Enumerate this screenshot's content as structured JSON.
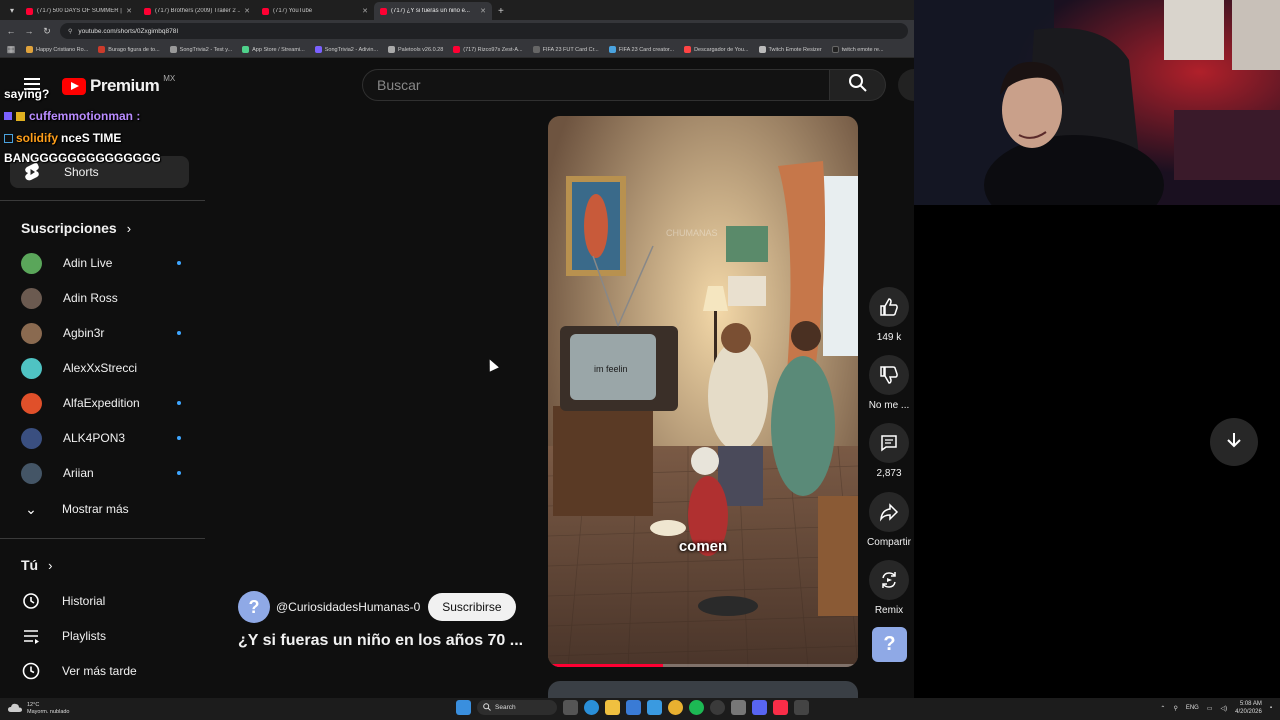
{
  "browser": {
    "tabs": [
      {
        "title": "(717) 500 DAYS OF SUMMER | ...",
        "active": false
      },
      {
        "title": "(717) Brothers (2009) Trailer 2 ...",
        "active": false
      },
      {
        "title": "(717) YouTube",
        "active": false
      },
      {
        "title": "(717) ¿Y si fueras un niño e...",
        "active": true
      }
    ],
    "url": "youtube.com/shorts/0Zxgimbq878I",
    "bookmarks": [
      "Happy Cristiano Ro...",
      "Burago figura de to...",
      "SongTrivia2 - Test y...",
      "App Store / Streami...",
      "SongTrivia2 - Adivin...",
      "Paletools v26.0.28",
      "(717) Rizco97s Zest-A...",
      "FIFA 23 FUT Card Cr...",
      "FIFA 23 Card creator...",
      "Descargador de You...",
      "Twitch Emote Resizer",
      "twitch emote re..."
    ]
  },
  "youtube": {
    "logo_text": "Premium",
    "region": "MX",
    "search_placeholder": "Buscar",
    "shorts_label": "Shorts",
    "subscriptions_heading": "Suscripciones",
    "subscriptions": [
      {
        "name": "Adin Live",
        "new": true,
        "color": "#5aa65a"
      },
      {
        "name": "Adin Ross",
        "new": false,
        "color": "#6b5a50"
      },
      {
        "name": "Agbin3r",
        "new": true,
        "color": "#8a6a50"
      },
      {
        "name": "AlexXxStrecci",
        "new": false,
        "color": "#4fc3c3"
      },
      {
        "name": "AlfaExpedition",
        "new": true,
        "color": "#e0502a"
      },
      {
        "name": "ALK4PON3",
        "new": true,
        "color": "#3a4f80"
      },
      {
        "name": "Ariian",
        "new": true,
        "color": "#445566"
      }
    ],
    "show_more": "Mostrar más",
    "you_heading": "Tú",
    "you_items": [
      {
        "label": "Historial",
        "icon": "history-icon"
      },
      {
        "label": "Playlists",
        "icon": "playlists-icon"
      },
      {
        "label": "Ver más tarde",
        "icon": "watch-later-icon"
      }
    ],
    "video": {
      "caption": "comen",
      "tv_text": "im feelin",
      "watermark": "CHUMANAS",
      "progress": 0.37,
      "channel": "@CuriosidadesHumanas-0",
      "subscribe_label": "Suscribirse",
      "title": "¿Y si fueras un niño en los años 70 ..."
    },
    "actions": {
      "likes": "149 k",
      "dislike_label": "No me ...",
      "comments": "2,873",
      "share_label": "Compartir",
      "remix_label": "Remix"
    }
  },
  "chat": [
    {
      "text": "saying?",
      "color": "#ffffff"
    },
    {
      "text": "cuffemmotionman :",
      "color": "#b98cff"
    },
    {
      "text": "solidify",
      "color": "#ff9f1a"
    },
    {
      "text": "nceS",
      "color": "#ffffff"
    },
    {
      "text": "TIME",
      "color": "#ffffff"
    },
    {
      "text": "BANGGGGGGGGGGGGGG",
      "color": "#ffffff"
    }
  ],
  "taskbar": {
    "weather_temp": "12°C",
    "weather_desc": "Mayorm. nublado",
    "search_label": "Search",
    "language": "ENG",
    "time": "5:08 AM",
    "date": "4/20/2026"
  }
}
